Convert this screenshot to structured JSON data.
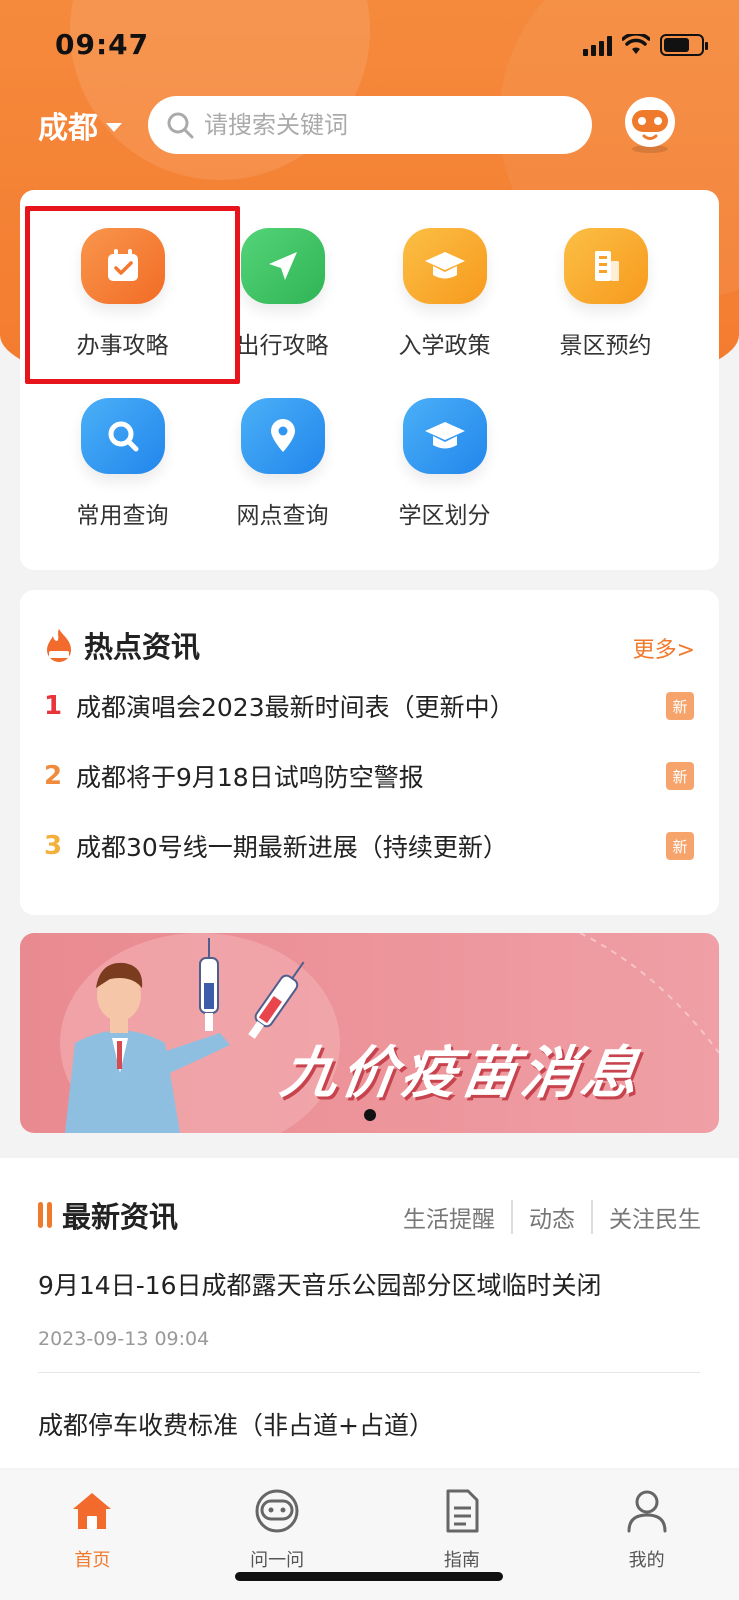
{
  "status": {
    "time": "09:47"
  },
  "header": {
    "city": "成都",
    "search_placeholder": "请搜索关键词"
  },
  "grid": [
    {
      "label": "办事攻略",
      "icon": "calendar-check-icon",
      "color": "#f6813a"
    },
    {
      "label": "出行攻略",
      "icon": "navigation-arrow-icon",
      "color": "#3fc564"
    },
    {
      "label": "入学政策",
      "icon": "graduation-cap-icon",
      "color": "#f9ab2e"
    },
    {
      "label": "景区预约",
      "icon": "building-icon",
      "color": "#f9ab2e"
    },
    {
      "label": "常用查询",
      "icon": "search-icon",
      "color": "#2f9cf4"
    },
    {
      "label": "网点查询",
      "icon": "location-pin-icon",
      "color": "#2f9cf4"
    },
    {
      "label": "学区划分",
      "icon": "graduation-cap-icon",
      "color": "#2f9cf4"
    }
  ],
  "hot": {
    "title": "热点资讯",
    "more": "更多>",
    "badge": "新",
    "items": [
      {
        "rank": "1",
        "text": "成都演唱会2023最新时间表（更新中）",
        "color": "#e8353b"
      },
      {
        "rank": "2",
        "text": "成都将于9月18日试鸣防空警报",
        "color": "#f08a3c"
      },
      {
        "rank": "3",
        "text": "成都30号线一期最新进展（持续更新）",
        "color": "#f3b13b"
      }
    ]
  },
  "banner": {
    "text": "九价疫苗消息"
  },
  "latest": {
    "title": "最新资讯",
    "tabs": [
      "生活提醒",
      "动态",
      "关注民生"
    ],
    "items": [
      {
        "title": "9月14日-16日成都露天音乐公园部分区域临时关闭",
        "date": "2023-09-13 09:04"
      },
      {
        "title": "成都停车收费标准（非占道+占道）",
        "date": ""
      }
    ]
  },
  "nav": [
    {
      "label": "首页",
      "icon": "home-icon",
      "active": true
    },
    {
      "label": "问一问",
      "icon": "robot-icon",
      "active": false
    },
    {
      "label": "指南",
      "icon": "document-icon",
      "active": false
    },
    {
      "label": "我的",
      "icon": "user-icon",
      "active": false
    }
  ]
}
